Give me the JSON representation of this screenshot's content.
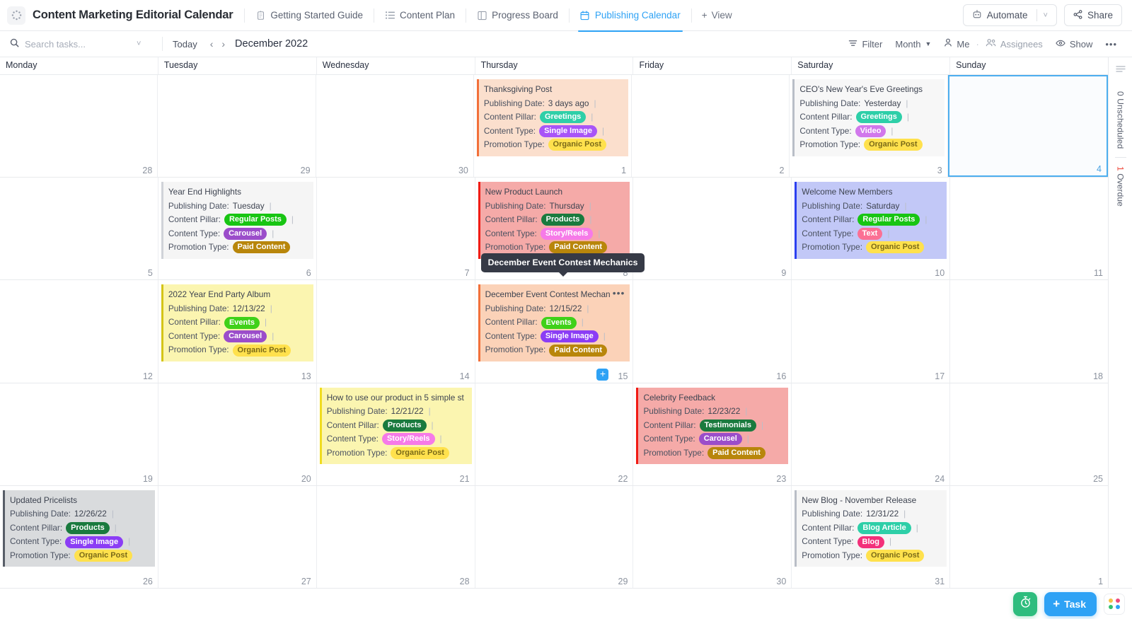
{
  "header": {
    "logo_icon": "clickup-logo-icon",
    "doc_title": "Content Marketing Editorial Calendar",
    "tabs": [
      {
        "label": "Getting Started Guide",
        "icon": "doc-icon",
        "active": false
      },
      {
        "label": "Content Plan",
        "icon": "list-icon",
        "active": false
      },
      {
        "label": "Progress Board",
        "icon": "board-icon",
        "active": false
      },
      {
        "label": "Publishing Calendar",
        "icon": "calendar-icon",
        "active": true
      }
    ],
    "add_view_label": "View",
    "automate_label": "Automate",
    "share_label": "Share"
  },
  "toolbar": {
    "search_placeholder": "Search tasks...",
    "search_value": "",
    "today_label": "Today",
    "prev_label": "‹",
    "next_label": "›",
    "month_label": "December 2022",
    "filter_label": "Filter",
    "view_mode_label": "Month",
    "me_label": "Me",
    "assignees_label": "Assignees",
    "show_label": "Show",
    "more_label": "•••"
  },
  "calendar": {
    "day_headers": [
      "Monday",
      "Tuesday",
      "Wednesday",
      "Thursday",
      "Friday",
      "Saturday",
      "Sunday"
    ],
    "field_labels": {
      "publishing_date": "Publishing Date:",
      "content_pillar": "Content Pillar:",
      "content_type": "Content Type:",
      "promotion_type": "Promotion Type:"
    },
    "tooltip": {
      "text": "December Event Contest Mechanics"
    },
    "add_button_label": "+",
    "weeks": [
      {
        "days": [
          {
            "num": "28",
            "other_month": true,
            "today": false,
            "card": null
          },
          {
            "num": "29",
            "other_month": true,
            "today": false,
            "card": null
          },
          {
            "num": "30",
            "other_month": true,
            "today": false,
            "card": null
          },
          {
            "num": "1",
            "other_month": false,
            "today": false,
            "card": {
              "title": "Thanksgiving Post",
              "date_value": "3 days ago",
              "pillar": "Greetings",
              "pillar_color": "#2ecfa8",
              "pillar_text": "#ffffff",
              "type": "Single Image",
              "type_color": "#a855f7",
              "type_text": "#ffffff",
              "promo": "Organic Post",
              "promo_color": "#ffe14d",
              "promo_text": "#7a6a18",
              "bg": "#fbdfcd",
              "bar": "#f2703a",
              "menu": false
            }
          },
          {
            "num": "2",
            "other_month": false,
            "today": false,
            "card": null
          },
          {
            "num": "3",
            "other_month": false,
            "today": false,
            "card": {
              "title": "CEO's New Year's Eve Greetings",
              "date_value": "Yesterday",
              "pillar": "Greetings",
              "pillar_color": "#2ecfa8",
              "pillar_text": "#ffffff",
              "type": "Video",
              "type_color": "#d178ec",
              "type_text": "#ffffff",
              "promo": "Organic Post",
              "promo_color": "#ffe14d",
              "promo_text": "#7a6a18",
              "bg": "#f7f7f7",
              "bar": "#b9bec7",
              "menu": false
            }
          },
          {
            "num": "4",
            "other_month": false,
            "today": true,
            "card": null
          }
        ]
      },
      {
        "days": [
          {
            "num": "5",
            "other_month": false,
            "today": false,
            "card": null
          },
          {
            "num": "6",
            "other_month": false,
            "today": false,
            "card": {
              "title": "Year End Highlights",
              "date_value": "Tuesday",
              "pillar": "Regular Posts",
              "pillar_color": "#18c513",
              "pillar_text": "#ffffff",
              "type": "Carousel",
              "type_color": "#9b4dca",
              "type_text": "#ffffff",
              "promo": "Paid Content",
              "promo_color": "#b8860b",
              "promo_text": "#ffffff",
              "bg": "#f5f5f5",
              "bar": "#d0d3d8",
              "menu": false
            }
          },
          {
            "num": "7",
            "other_month": false,
            "today": false,
            "card": null
          },
          {
            "num": "8",
            "other_month": false,
            "today": false,
            "card": {
              "title": "New Product Launch",
              "date_value": "Thursday",
              "pillar": "Products",
              "pillar_color": "#1a7a3e",
              "pillar_text": "#ffffff",
              "type": "Story/Reels",
              "type_color": "#f67ae8",
              "type_text": "#ffffff",
              "promo": "Paid Content",
              "promo_color": "#b8860b",
              "promo_text": "#ffffff",
              "bg": "#f5aaa8",
              "bar": "#f01b14",
              "menu": false
            }
          },
          {
            "num": "9",
            "other_month": false,
            "today": false,
            "card": null
          },
          {
            "num": "10",
            "other_month": false,
            "today": false,
            "card": {
              "title": "Welcome New Members",
              "date_value": "Saturday",
              "pillar": "Regular Posts",
              "pillar_color": "#18c513",
              "pillar_text": "#ffffff",
              "type": "Text",
              "type_color": "#fb7094",
              "type_text": "#ffffff",
              "promo": "Organic Post",
              "promo_color": "#ffe14d",
              "promo_text": "#7a6a18",
              "bg": "#c2c8f7",
              "bar": "#2b3ff0",
              "menu": false
            }
          },
          {
            "num": "11",
            "other_month": false,
            "today": false,
            "card": null
          }
        ]
      },
      {
        "days": [
          {
            "num": "12",
            "other_month": false,
            "today": false,
            "card": null
          },
          {
            "num": "13",
            "other_month": false,
            "today": false,
            "card": {
              "title": "2022 Year End Party Album",
              "date_value": "12/13/22",
              "pillar": "Events",
              "pillar_color": "#3fd119",
              "pillar_text": "#ffffff",
              "type": "Carousel",
              "type_color": "#9b4dca",
              "type_text": "#ffffff",
              "promo": "Organic Post",
              "promo_color": "#ffe14d",
              "promo_text": "#7a6a18",
              "bg": "#fbf5b0",
              "bar": "#d4c418",
              "menu": false
            }
          },
          {
            "num": "14",
            "other_month": false,
            "today": false,
            "card": null
          },
          {
            "num": "15",
            "other_month": false,
            "today": false,
            "add_button": true,
            "card": {
              "title": "December Event Contest Mechan",
              "date_value": "12/15/22",
              "pillar": "Events",
              "pillar_color": "#3fd119",
              "pillar_text": "#ffffff",
              "type": "Single Image",
              "type_color": "#8b3df5",
              "type_text": "#ffffff",
              "promo": "Paid Content",
              "promo_color": "#b8860b",
              "promo_text": "#ffffff",
              "bg": "#fbd2b8",
              "bar": "#f2703a",
              "menu": true,
              "tooltip": true
            }
          },
          {
            "num": "16",
            "other_month": false,
            "today": false,
            "card": null
          },
          {
            "num": "17",
            "other_month": false,
            "today": false,
            "card": null
          },
          {
            "num": "18",
            "other_month": false,
            "today": false,
            "card": null
          }
        ]
      },
      {
        "days": [
          {
            "num": "19",
            "other_month": false,
            "today": false,
            "card": null
          },
          {
            "num": "20",
            "other_month": false,
            "today": false,
            "card": null
          },
          {
            "num": "21",
            "other_month": false,
            "today": false,
            "card": {
              "title": "How to use our product in 5 simple st",
              "date_value": "12/21/22",
              "pillar": "Products",
              "pillar_color": "#1a7a3e",
              "pillar_text": "#ffffff",
              "type": "Story/Reels",
              "type_color": "#f67ae8",
              "type_text": "#ffffff",
              "promo": "Organic Post",
              "promo_color": "#ffe14d",
              "promo_text": "#7a6a18",
              "bg": "#fbf5b0",
              "bar": "#f0dc1e",
              "menu": false
            }
          },
          {
            "num": "22",
            "other_month": false,
            "today": false,
            "card": null
          },
          {
            "num": "23",
            "other_month": false,
            "today": false,
            "card": {
              "title": "Celebrity Feedback",
              "date_value": "12/23/22",
              "pillar": "Testimonials",
              "pillar_color": "#1a7a3e",
              "pillar_text": "#ffffff",
              "type": "Carousel",
              "type_color": "#9b4dca",
              "type_text": "#ffffff",
              "promo": "Paid Content",
              "promo_color": "#b8860b",
              "promo_text": "#ffffff",
              "bg": "#f5aaa8",
              "bar": "#f01b14",
              "menu": false
            }
          },
          {
            "num": "24",
            "other_month": false,
            "today": false,
            "card": null
          },
          {
            "num": "25",
            "other_month": false,
            "today": false,
            "card": null
          }
        ]
      },
      {
        "days": [
          {
            "num": "26",
            "other_month": false,
            "today": false,
            "card": {
              "title": "Updated Pricelists",
              "date_value": "12/26/22",
              "pillar": "Products",
              "pillar_color": "#1a7a3e",
              "pillar_text": "#ffffff",
              "type": "Single Image",
              "type_color": "#8b3df5",
              "type_text": "#ffffff",
              "promo": "Organic Post",
              "promo_color": "#ffe14d",
              "promo_text": "#7a6a18",
              "bg": "#d9dbdd",
              "bar": "#585e68",
              "menu": false
            }
          },
          {
            "num": "27",
            "other_month": false,
            "today": false,
            "card": null
          },
          {
            "num": "28",
            "other_month": false,
            "today": false,
            "card": null
          },
          {
            "num": "29",
            "other_month": false,
            "today": false,
            "card": null
          },
          {
            "num": "30",
            "other_month": false,
            "today": false,
            "card": null
          },
          {
            "num": "31",
            "other_month": false,
            "today": false,
            "card": {
              "title": "New Blog - November Release",
              "date_value": "12/31/22",
              "pillar": "Blog Article",
              "pillar_color": "#2ecfa8",
              "pillar_text": "#ffffff",
              "type": "Blog",
              "type_color": "#f3307a",
              "type_text": "#ffffff",
              "promo": "Organic Post",
              "promo_color": "#ffe14d",
              "promo_text": "#7a6a18",
              "bg": "#f5f5f5",
              "bar": "#b9bec7",
              "menu": false
            }
          },
          {
            "num": "1",
            "other_month": true,
            "today": false,
            "card": null
          }
        ]
      }
    ]
  },
  "rail": {
    "menu_icon": "rail-menu-icon",
    "unscheduled_label": "0 Unscheduled",
    "overdue_count": "1",
    "overdue_label": " Overdue"
  },
  "bottom": {
    "timer_icon": "stopwatch-icon",
    "task_label": "Task",
    "apps_icon": "apps-grid-icon",
    "apps_colors": [
      "#f4c24a",
      "#ef4a7b",
      "#32c06e",
      "#2ea2f5"
    ]
  }
}
